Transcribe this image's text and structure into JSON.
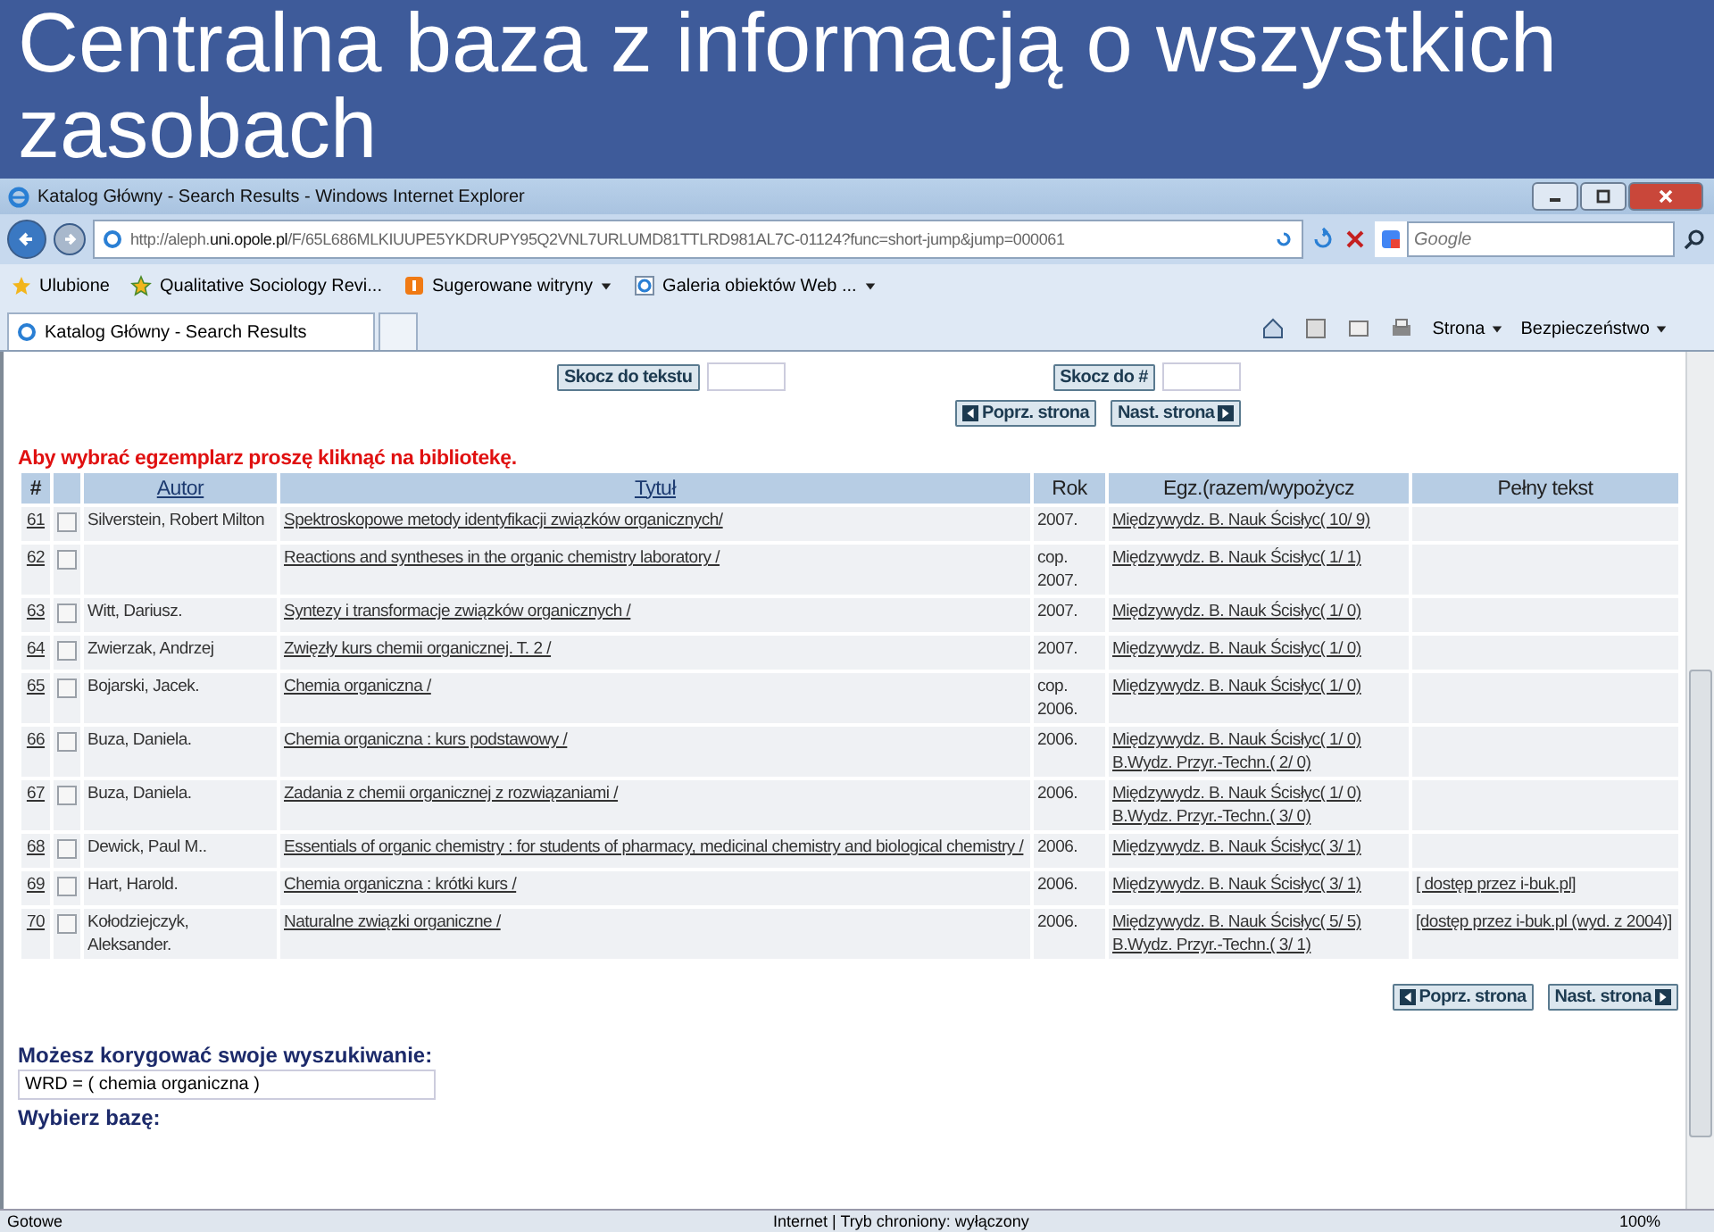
{
  "slide_title": "Centralna baza z informacją o wszystkich zasobach",
  "window": {
    "title": "Katalog Główny - Search Results - Windows Internet Explorer"
  },
  "address_bar": {
    "url": "http://aleph.**uni.opole.pl**/F/65L686MLKIUUPE5YKDRUPY95Q2VNL7URLUMD81TTLRD981AL7C-01124?func=short-jump&jump=000061"
  },
  "search": {
    "placeholder": "Google"
  },
  "favorites_bar": [
    {
      "label": "Ulubione",
      "kind": "star",
      "dropdown": false
    },
    {
      "label": "Qualitative Sociology Revi...",
      "kind": "site",
      "dropdown": false
    },
    {
      "label": "Sugerowane witryny",
      "kind": "suggest",
      "dropdown": true
    },
    {
      "label": "Galeria obiektów Web ...",
      "kind": "ie",
      "dropdown": true
    }
  ],
  "tabs": [
    {
      "label": "Katalog Główny - Search Results",
      "selected": true
    }
  ],
  "command_bar": [
    "Strona",
    "Bezpieczeństwo"
  ],
  "page": {
    "jump": [
      "Skocz do tekstu",
      "Skocz do #"
    ],
    "nav_top": {
      "prev": "Poprz. strona",
      "next": "Nast. strona"
    },
    "notice": "Aby wybrać egzemplarz proszę kliknąć na bibliotekę.",
    "table": {
      "columns": [
        {
          "label": "#",
          "link": false
        },
        {
          "label": "Autor",
          "link": true
        },
        {
          "label": "Tytuł",
          "link": true
        },
        {
          "label": "Rok",
          "link": false
        },
        {
          "label": "Egz.(razem/wypożycz",
          "link": false
        },
        {
          "label": "Pełny tekst",
          "link": false
        }
      ],
      "rows": [
        {
          "number": "61",
          "checked": false,
          "author": "Silverstein, Robert Milton",
          "title": "Spektroskopowe metody identyfikacji związków organicznych/",
          "year": "2007.",
          "holdings": [
            "Międzywydz. B. Nauk Ścisłyc( 10/ 9)"
          ]
        },
        {
          "number": "62",
          "checked": false,
          "title": "Reactions and syntheses in the organic chemistry laboratory /",
          "year": "cop. 2007.",
          "holdings": [
            "Międzywydz. B. Nauk Ścisłyc( 1/ 1)"
          ]
        },
        {
          "number": "63",
          "checked": false,
          "author": "Witt, Dariusz.",
          "title": "Syntezy i transformacje związków organicznych /",
          "year": "2007.",
          "holdings": [
            "Międzywydz. B. Nauk Ścisłyc( 1/ 0)"
          ]
        },
        {
          "number": "64",
          "checked": false,
          "author": "Zwierzak, Andrzej",
          "title": "Zwięzły kurs chemii organicznej. T. 2 /",
          "year": "2007.",
          "holdings": [
            "Międzywydz. B. Nauk Ścisłyc( 1/ 0)"
          ]
        },
        {
          "number": "65",
          "checked": false,
          "author": "Bojarski, Jacek.",
          "title": "Chemia organiczna /",
          "year": "cop. 2006.",
          "holdings": [
            "Międzywydz. B. Nauk Ścisłyc( 1/ 0)"
          ]
        },
        {
          "number": "66",
          "checked": false,
          "author": "Buza, Daniela.",
          "title": "Chemia organiczna : kurs podstawowy /",
          "year": "2006.",
          "holdings": [
            "Międzywydz. B. Nauk Ścisłyc( 1/ 0)",
            "B.Wydz. Przyr.-Techn.( 2/ 0)"
          ]
        },
        {
          "number": "67",
          "checked": false,
          "author": "Buza, Daniela.",
          "title": "Zadania z chemii organicznej z rozwiązaniami /",
          "year": "2006.",
          "holdings": [
            "Międzywydz. B. Nauk Ścisłyc( 1/ 0)",
            "B.Wydz. Przyr.-Techn.( 3/ 0)"
          ]
        },
        {
          "number": "68",
          "checked": false,
          "author": "Dewick, Paul M..",
          "title": "Essentials of organic chemistry : for students of pharmacy, medicinal chemistry and biological chemistry /",
          "year": "2006.",
          "holdings": [
            "Międzywydz. B. Nauk Ścisłyc( 3/ 1)"
          ]
        },
        {
          "number": "69",
          "checked": false,
          "author": "Hart, Harold.",
          "title": "Chemia organiczna : krótki kurs /",
          "year": "2006.",
          "holdings": [
            "Międzywydz. B. Nauk Ścisłyc( 3/ 1)"
          ],
          "full_text": "[ dostęp przez i-buk.pl]"
        },
        {
          "number": "70",
          "checked": false,
          "author": "Kołodziejczyk, Aleksander.",
          "title": "Naturalne związki organiczne /",
          "year": "2006.",
          "holdings": [
            "Międzywydz. B. Nauk Ścisłyc( 5/ 5)",
            "B.Wydz. Przyr.-Techn.( 3/ 1)"
          ],
          "full_text": "[dostęp przez i-buk.pl (wyd. z 2004)]"
        }
      ]
    },
    "nav_bottom": {
      "prev": "Poprz. strona",
      "next": "Nast. strona"
    },
    "refine": {
      "heading": "Możesz korygować swoje wyszukiwanie:",
      "query": "WRD = ( chemia organiczna )",
      "db_heading": "Wybierz bazę:"
    }
  },
  "status_bar": {
    "text": "Gotowe",
    "zone": "Internet | Tryb chroniony: wyłączony",
    "zoom": "100%"
  }
}
